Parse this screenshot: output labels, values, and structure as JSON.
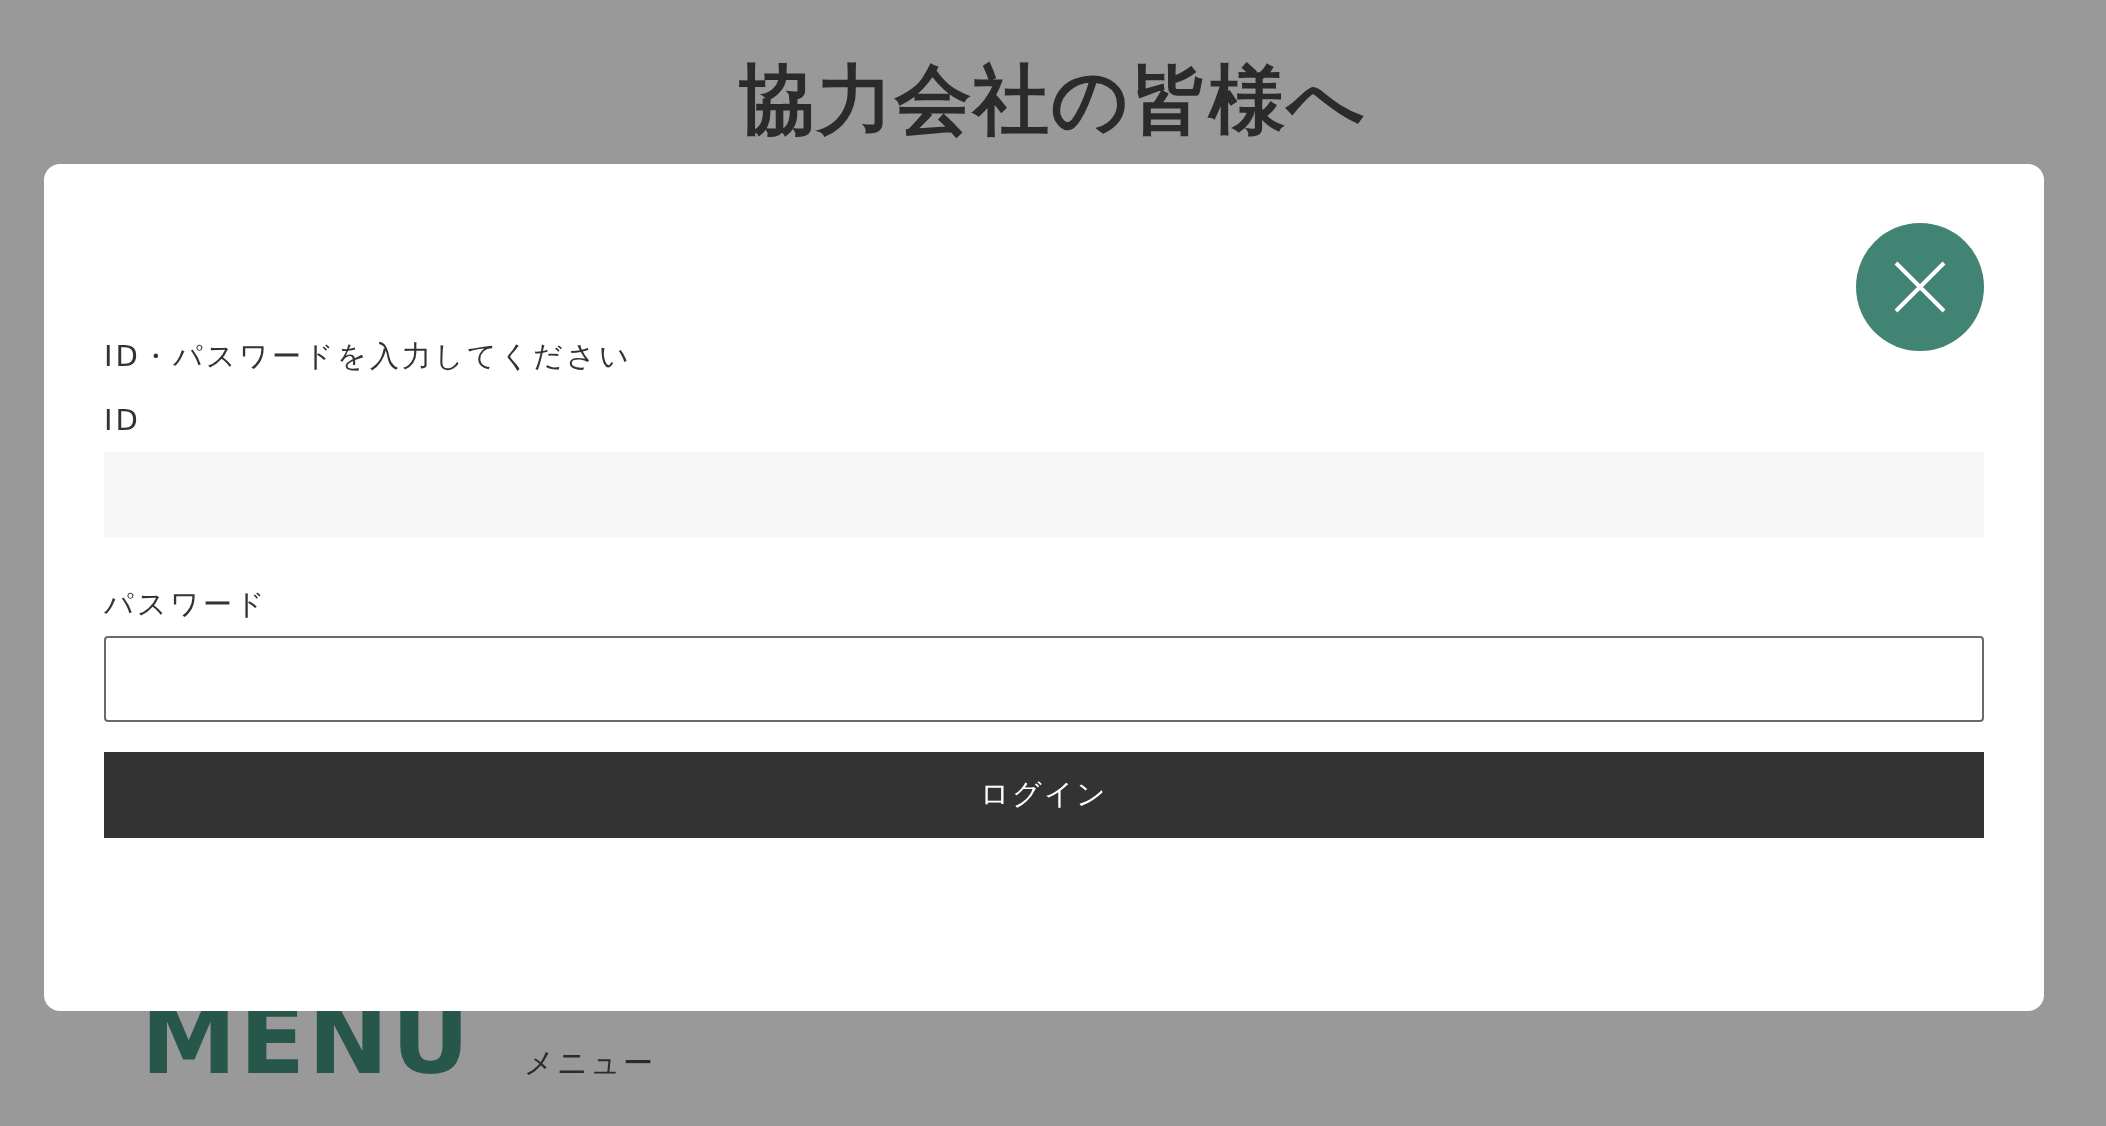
{
  "page": {
    "title": "協力会社の皆様へ",
    "menu": {
      "heading": "MENU",
      "subheading": "メニュー"
    }
  },
  "modal": {
    "instruction": "ID・パスワードを入力してください",
    "fields": [
      {
        "label": "ID",
        "kind": "text"
      },
      {
        "label": "パスワード",
        "kind": "password"
      }
    ],
    "submit": "ログイン"
  }
}
